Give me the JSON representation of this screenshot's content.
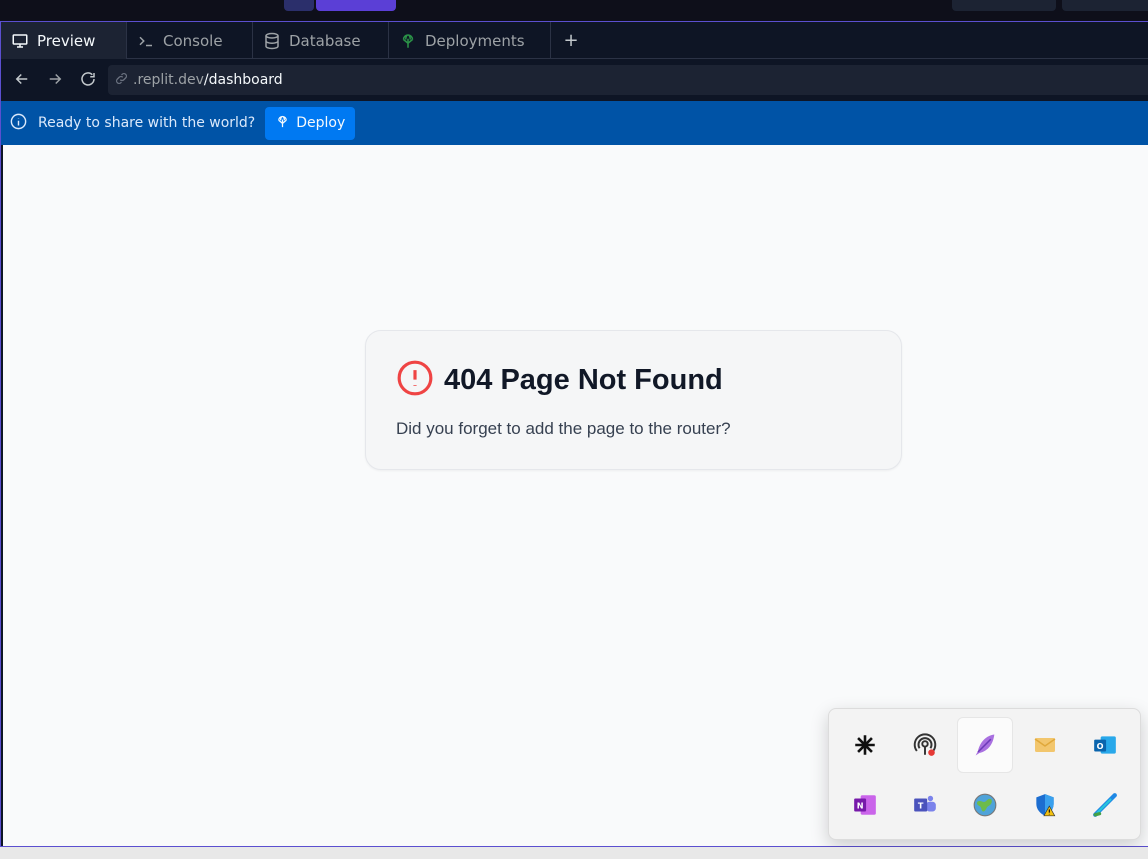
{
  "tabs": [
    {
      "label": "Preview",
      "icon": "monitor-icon",
      "active": true
    },
    {
      "label": "Console",
      "icon": "terminal-icon",
      "active": false
    },
    {
      "label": "Database",
      "icon": "database-icon",
      "active": false
    },
    {
      "label": "Deployments",
      "icon": "deploy-icon",
      "active": false
    }
  ],
  "tab_add_label": "+",
  "address": {
    "host": ".replit.dev",
    "path": "/dashboard"
  },
  "banner": {
    "text": "Ready to share with the world?",
    "button_label": "Deploy"
  },
  "error_card": {
    "title": "404 Page Not Found",
    "message": "Did you forget to add the page to the router?",
    "icon_color": "#ef4444"
  },
  "tray_icons": [
    "asterisk-app-icon",
    "podcast-icon",
    "feather-icon",
    "mail-icon",
    "outlook-icon",
    "onenote-icon",
    "teams-icon",
    "globe-icon",
    "defender-warning-icon",
    "stroke-app-icon"
  ],
  "colors": {
    "banner_bg": "#0053a6",
    "deploy_button": "#0079f2",
    "pane_border": "#5b4fd0"
  }
}
